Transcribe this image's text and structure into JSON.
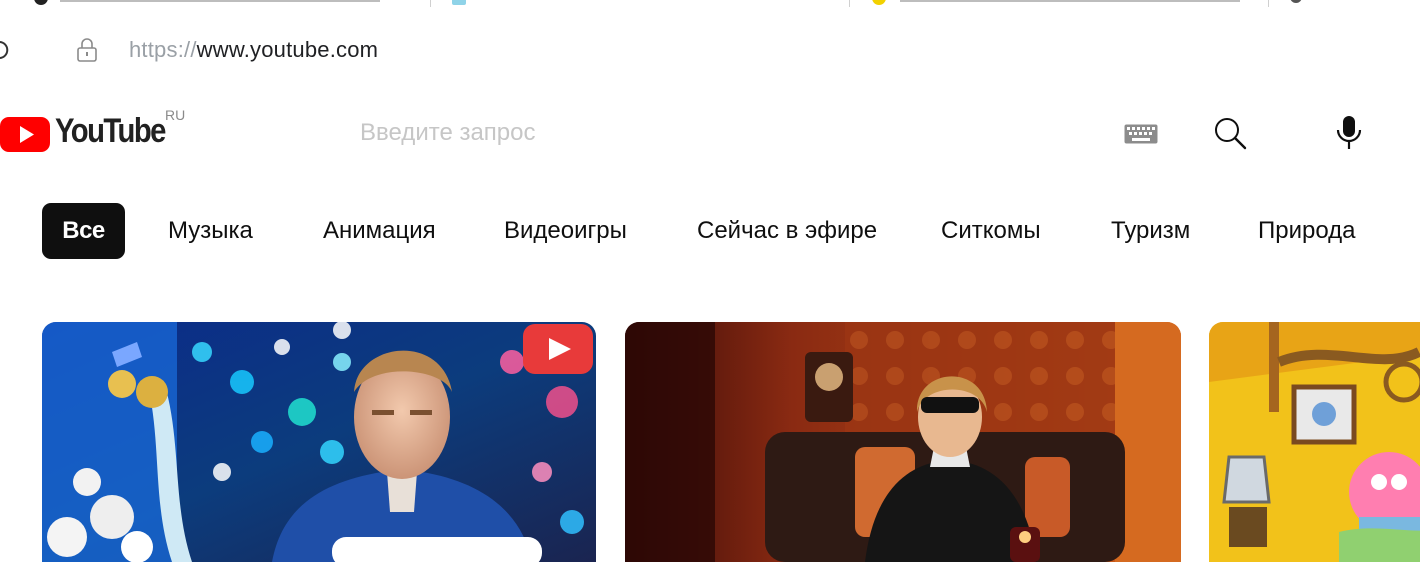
{
  "browser": {
    "url_scheme": "https://",
    "url_host": "www.youtube.com"
  },
  "masthead": {
    "logo_text": "YouTube",
    "region": "RU",
    "search_placeholder": "Введите запрос"
  },
  "chips": [
    {
      "label": "Все",
      "active": true
    },
    {
      "label": "Музыка"
    },
    {
      "label": "Анимация"
    },
    {
      "label": "Видеоигры"
    },
    {
      "label": "Сейчас в эфире"
    },
    {
      "label": "Ситкомы"
    },
    {
      "label": "Туризм"
    },
    {
      "label": "Природа"
    }
  ],
  "colors": {
    "brand_red": "#ff0000",
    "chip_active_bg": "#0f0f0f",
    "text": "#0f0f0f"
  },
  "icons": [
    "reload-icon",
    "lock-icon",
    "youtube-play-icon",
    "keyboard-icon",
    "search-icon",
    "microphone-icon",
    "video-play-icon"
  ]
}
